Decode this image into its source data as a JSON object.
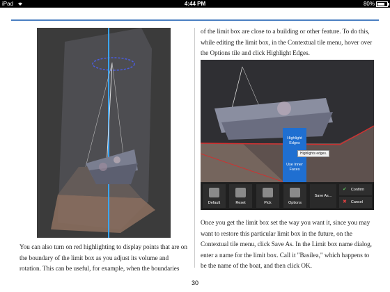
{
  "status_bar": {
    "device": "iPad",
    "time": "4:44 PM",
    "battery": "80%",
    "battery_level": 0.8
  },
  "left_paragraph": "You can also turn on red highlighting to display points that are on the boundary of the limit box as you adjust its volume and rotation. This can be useful, for example, when the boundaries",
  "right_paragraph_top": "of the limit box are close to a building or other feature. To do this, while editing the limit box, in the Contextual tile menu, hover over the Options tile and click Highlight Edges.",
  "right_paragraph_bottom": "Once you get the limit box set the way you want it, since you may want to restore this particular limit box in the future, on the Contextual tile menu, click Save As. In the Limit box name dialog, enter a name for the limit box. Call it \"Basilea,\" which happens to be the name of the boat, and then click OK.",
  "page_number": "30",
  "screenshot_ui": {
    "tiles": [
      "Default",
      "Reset",
      "Pick",
      "Options"
    ],
    "save_as": "Save As...",
    "confirm": "Confirm",
    "cancel": "Cancel",
    "options_menu": {
      "highlight_line1": "Highlight",
      "highlight_line2": "Edges",
      "use_inner_line1": "Use Inner",
      "use_inner_line2": "Faces"
    },
    "tooltip": "Highlights edges."
  },
  "colors": {
    "accent_blue": "#4a7fc1",
    "menu_blue": "#1f6fd1",
    "highlight_red": "#d03030"
  }
}
